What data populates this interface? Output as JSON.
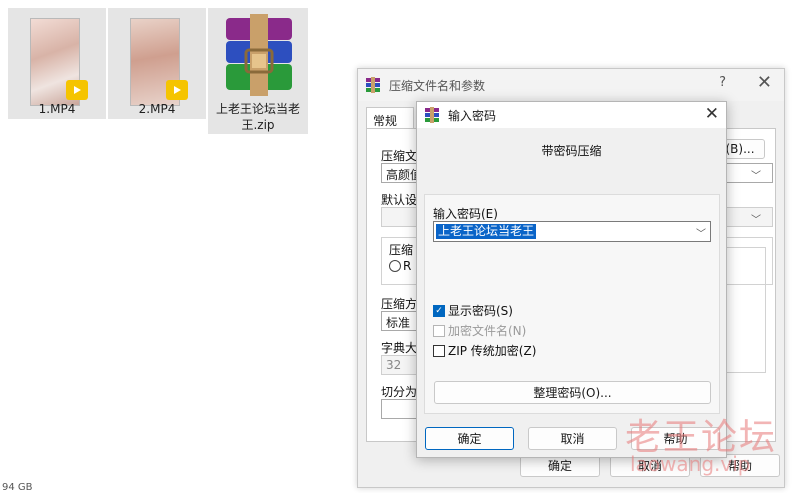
{
  "desktop": {
    "files": [
      {
        "name": "1.MP4",
        "badge": "Player"
      },
      {
        "name": "2.MP4",
        "badge": "Player"
      },
      {
        "name_line1": "上老王论坛当老",
        "name_line2": "王.zip"
      }
    ],
    "status_fragment": "94 GB"
  },
  "archive_dialog": {
    "title": "压缩文件名和参数",
    "help_glyph": "?",
    "close_glyph": "✕",
    "tab_general": "常规",
    "archive_name_label": "压缩文",
    "archive_name_value": "高颜值",
    "browse_label": "(B)...",
    "profile_label": "默认设",
    "format_group_label": "压缩",
    "format_radio_label": "R",
    "method_label": "压缩方",
    "method_value": "标准",
    "dict_label": "字典大",
    "dict_value": "32",
    "split_label": "切分为",
    "ok_label": "确定",
    "cancel_label": "取消",
    "help_label": "帮助"
  },
  "password_dialog": {
    "title": "输入密码",
    "close_glyph": "✕",
    "heading": "带密码压缩",
    "field_label": "输入密码(E)",
    "password_value": "上老王论坛当老王",
    "show_password_label": "显示密码(S)",
    "show_password_checked": true,
    "encrypt_names_label": "加密文件名(N)",
    "encrypt_names_checked": false,
    "zip_legacy_label": "ZIP 传统加密(Z)",
    "zip_legacy_checked": false,
    "organize_label": "整理密码(O)...",
    "ok_label": "确定",
    "cancel_label": "取消",
    "help_label": "帮助"
  },
  "watermark": {
    "line1": "老王论坛",
    "line2": "laowang.vip"
  },
  "colors": {
    "selection": "#0a64c8",
    "checkbox": "#0067c0",
    "player_badge": "#f5c400",
    "watermark": "#e87878"
  }
}
